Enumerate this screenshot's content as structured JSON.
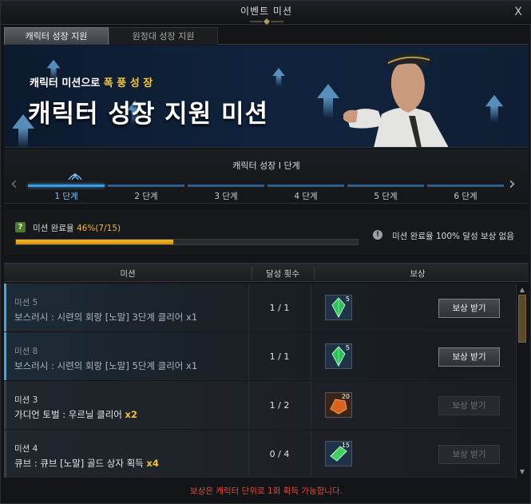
{
  "window": {
    "title": "이벤트 미션",
    "close_label": "X"
  },
  "tabs": [
    {
      "label": "캐릭터 성장 지원",
      "active": true
    },
    {
      "label": "원정대 성장 지원",
      "active": false
    }
  ],
  "banner": {
    "subtitle_pre": "캐릭터 미션으로 ",
    "subtitle_highlight": "폭 풍 성 장",
    "title": "캐릭터 성장 지원 미션"
  },
  "stages": {
    "title": "캐릭터 성장 Ⅰ 단계",
    "prev_icon": "chevron-left-icon",
    "next_icon": "chevron-right-icon",
    "items": [
      {
        "label": "1 단계",
        "active": true
      },
      {
        "label": "2 단계",
        "active": false
      },
      {
        "label": "3 단계",
        "active": false
      },
      {
        "label": "4 단계",
        "active": false
      },
      {
        "label": "5 단계",
        "active": false
      },
      {
        "label": "6 단계",
        "active": false
      }
    ]
  },
  "progress": {
    "label": "미션 완료율",
    "value_text": "46%(7/15)",
    "fraction": 0.46,
    "info_text": "미션 완료율 100% 달성 보상 없음"
  },
  "table": {
    "headers": {
      "mission": "미션",
      "count": "달성 횟수",
      "reward": "보상"
    },
    "rows": [
      {
        "name": "미션 5",
        "desc": "보스러시 : 시련의 회랑 [노말] 3단계 클리어 ",
        "mult": "x1",
        "count": "1 / 1",
        "reward_qty": "5",
        "reward_icon": "green-crystal-icon",
        "claim": "보상 받기",
        "state": "done"
      },
      {
        "name": "미션 8",
        "desc": "보스러시 : 시련의 회랑 [노말] 5단계 클리어 ",
        "mult": "x1",
        "count": "1 / 1",
        "reward_qty": "5",
        "reward_icon": "green-crystal-icon",
        "claim": "보상 받기",
        "state": "done"
      },
      {
        "name": "미션 3",
        "desc": "가디언 토벌 : 우르닐 클리어 ",
        "mult": "x2",
        "count": "1 / 2",
        "reward_qty": "20",
        "reward_icon": "orange-stone-icon",
        "claim": "보상 받기",
        "state": "active"
      },
      {
        "name": "미션 4",
        "desc": "큐브 : 큐브 [노말] 골드 상자 획득 ",
        "mult": "x4",
        "count": "0 / 4",
        "reward_qty": "15",
        "reward_icon": "green-gem-icon",
        "claim": "보상 받기",
        "state": "active"
      }
    ]
  },
  "footer": "보상은 캐릭터 단위로 1회 획득 가능합니다.",
  "colors": {
    "accent": "#3f9be0",
    "progress": "#f3b72d",
    "highlight": "#f1c232",
    "warning": "#e04a3c"
  }
}
